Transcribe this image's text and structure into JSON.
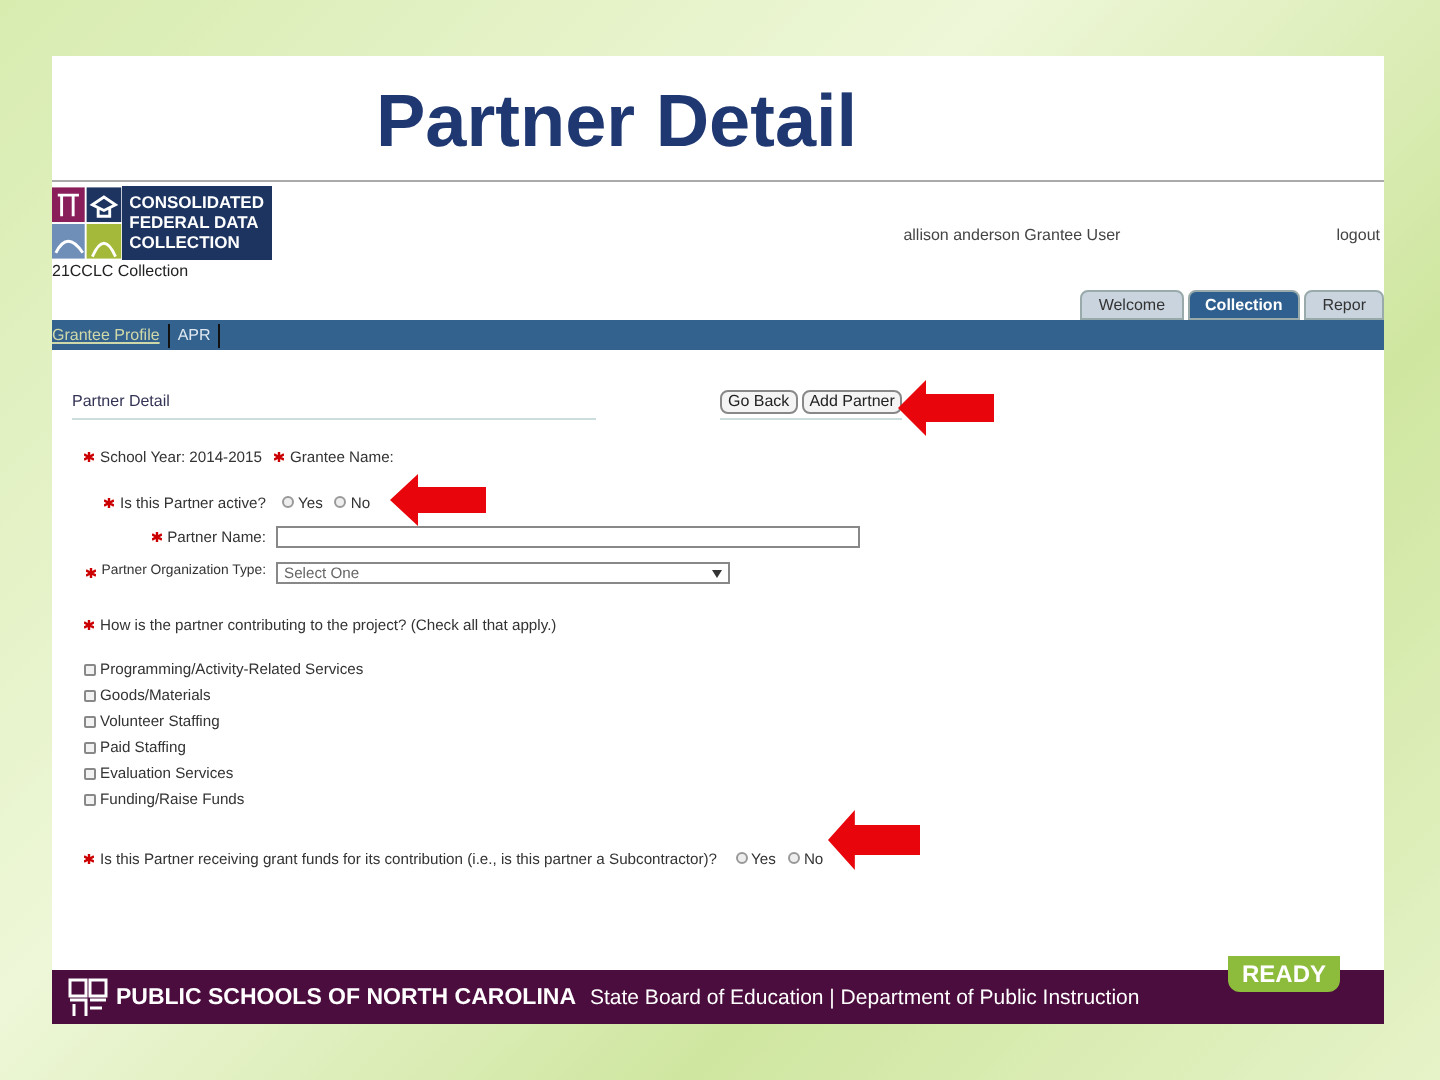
{
  "slide": {
    "title": "Partner Detail"
  },
  "app": {
    "logo_lines": [
      "CONSOLIDATED",
      "FEDERAL DATA",
      "COLLECTION"
    ],
    "collection": "21CCLC Collection",
    "user": "allison anderson Grantee User",
    "logout": "logout",
    "tabs": [
      {
        "label": "Welcome",
        "selected": false
      },
      {
        "label": "Collection",
        "selected": true
      },
      {
        "label": "Repor",
        "selected": false
      }
    ],
    "nav": [
      {
        "label": "Grantee Profile",
        "kind": "link"
      },
      {
        "label": "APR",
        "kind": "plain"
      }
    ]
  },
  "form": {
    "heading": "Partner Detail",
    "buttons": [
      "Go Back",
      "Add Partner"
    ],
    "rows": [
      {
        "kind": "info",
        "items": [
          {
            "required": true,
            "label": "School Year:",
            "value": "2014-2015"
          },
          {
            "required": true,
            "label": "Grantee Name:"
          }
        ]
      },
      {
        "kind": "radio",
        "required": true,
        "label": "Is this Partner active?",
        "options": [
          {
            "label": "Yes",
            "selected": false
          },
          {
            "label": "No",
            "selected": false
          }
        ]
      },
      {
        "kind": "text",
        "required": true,
        "label": "Partner Name:"
      },
      {
        "kind": "select",
        "required": true,
        "label": "Partner Organization Type:",
        "value": "Select One"
      },
      {
        "kind": "checks",
        "required": true,
        "label": "How is the partner contributing to the project? (Check all that apply.)",
        "options": [
          {
            "label": "Programming/Activity-Related Services",
            "checked": false
          },
          {
            "label": "Goods/Materials",
            "checked": false
          },
          {
            "label": "Volunteer Staffing",
            "checked": false
          },
          {
            "label": "Paid Staffing",
            "checked": false
          },
          {
            "label": "Evaluation Services",
            "checked": false
          },
          {
            "label": "Funding/Raise Funds",
            "checked": false
          }
        ]
      },
      {
        "kind": "wide-radio",
        "required": true,
        "label": "Is this Partner receiving grant funds for its contribution (i.e., is this partner a Subcontractor)?",
        "options": [
          {
            "label": "Yes",
            "selected": false
          },
          {
            "label": "No",
            "selected": false
          }
        ]
      }
    ]
  },
  "footer": {
    "org": "PUBLIC SCHOOLS OF NORTH CAROLINA",
    "sub": "State Board of Education | Department of Public Instruction",
    "badge": "READY"
  }
}
